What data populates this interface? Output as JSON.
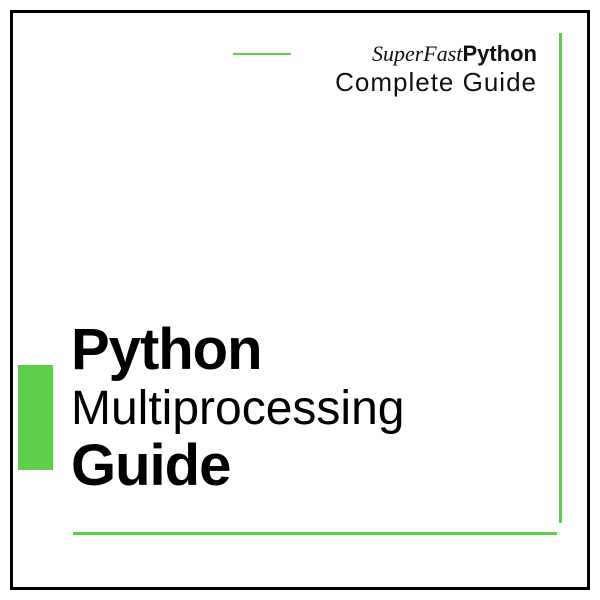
{
  "header": {
    "brand_prefix": "SuperFast",
    "brand_suffix": "Python",
    "subtitle": "Complete Guide"
  },
  "title": {
    "line1": "Python",
    "line2": "Multiprocessing",
    "line3": "Guide"
  },
  "colors": {
    "accent": "#5fce4b",
    "text": "#000000"
  }
}
